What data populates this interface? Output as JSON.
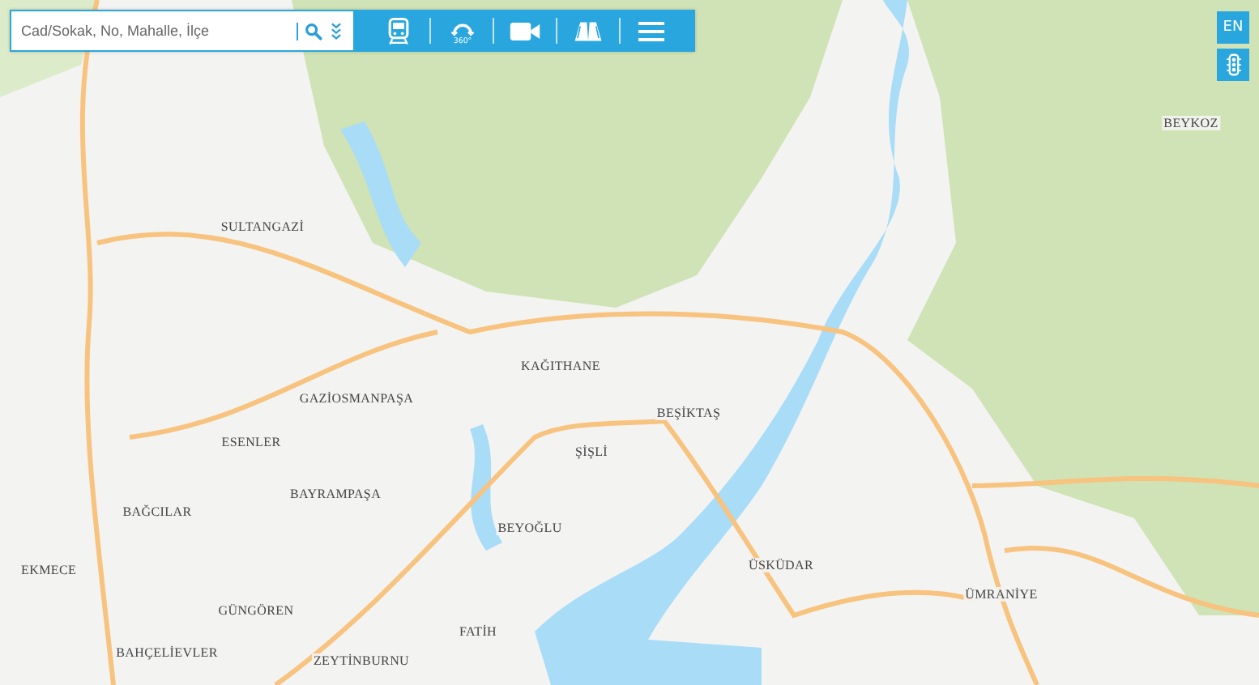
{
  "search": {
    "placeholder": "Cad/Sokak, No, Mahalle, İlçe"
  },
  "toolbar": [
    {
      "kind": "train"
    },
    {
      "kind": "panorama",
      "label": "360°"
    },
    {
      "kind": "camera"
    },
    {
      "kind": "book"
    },
    {
      "kind": "menu"
    }
  ],
  "side_buttons": [
    {
      "kind": "text",
      "label": "EN"
    },
    {
      "kind": "traffic"
    }
  ],
  "map": {
    "districts": [
      "BEYKOZ",
      "SULTANGAZİ",
      "KAĞITHANE",
      "GAZİOSMANPAŞA",
      "BEŞİKTAŞ",
      "ESENLER",
      "ŞİŞLİ",
      "BAYRAMPAŞA",
      "BAĞCILAR",
      "BEYOĞLU",
      "ÜSKÜDAR",
      "EKMECE",
      "ÜMRANİYE",
      "GÜNGÖREN",
      "FATİH",
      "BAHÇELİEVLER",
      "ZEYTİNBURNU"
    ]
  }
}
